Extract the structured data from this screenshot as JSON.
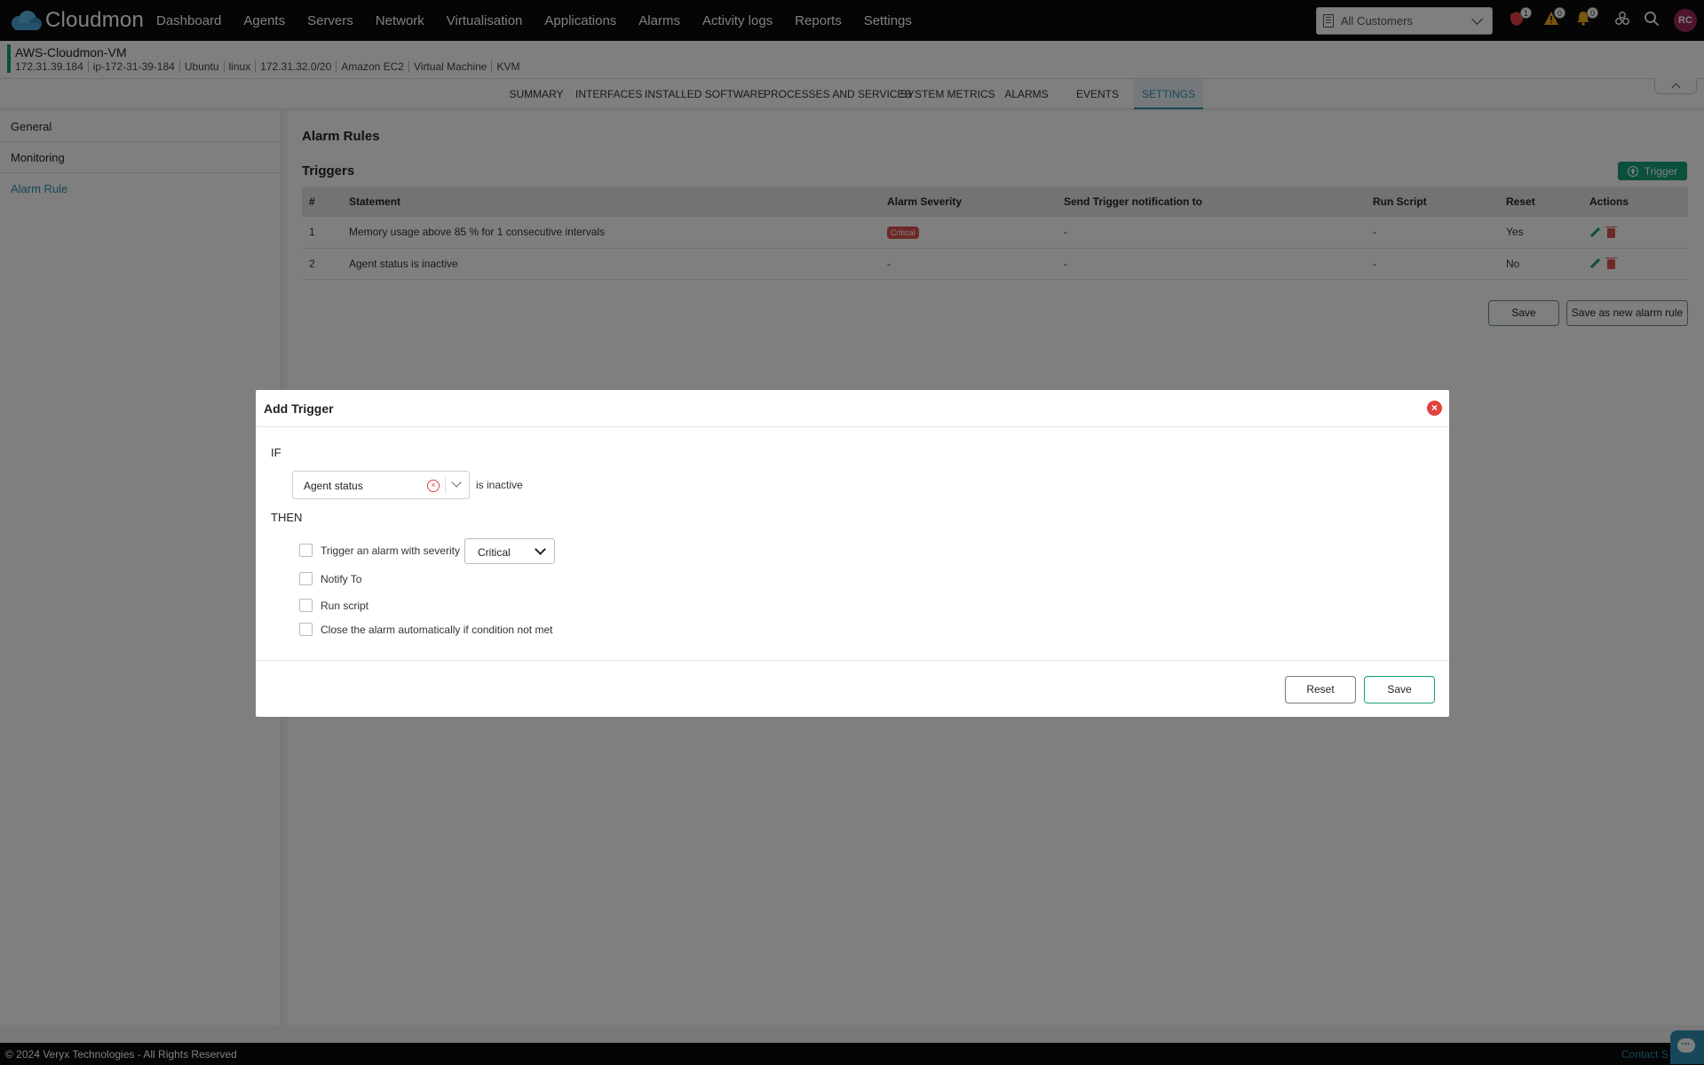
{
  "app": {
    "name": "Cloudmon"
  },
  "nav": [
    "Dashboard",
    "Agents",
    "Servers",
    "Network",
    "Virtualisation",
    "Applications",
    "Alarms",
    "Activity logs",
    "Reports",
    "Settings"
  ],
  "customer_select": {
    "value": "All Customers"
  },
  "notifications": {
    "critical": "1",
    "warning": "0",
    "info": "0"
  },
  "user": {
    "initials": "RC"
  },
  "device": {
    "name": "AWS-Cloudmon-VM",
    "meta": [
      "172.31.39.184",
      "ip-172-31-39-184",
      "Ubuntu",
      "linux",
      "172.31.32.0/20",
      "Amazon EC2",
      "Virtual Machine",
      "KVM"
    ]
  },
  "tabs": [
    "SUMMARY",
    "INTERFACES",
    "INSTALLED SOFTWARE",
    "PROCESSES AND SERVICES",
    "SYSTEM METRICS",
    "ALARMS",
    "EVENTS",
    "SETTINGS"
  ],
  "active_tab": "SETTINGS",
  "leftmenu": [
    "General",
    "Monitoring",
    "Alarm Rule"
  ],
  "active_leftmenu": "Alarm Rule",
  "alarm_rules": {
    "title": "Alarm Rules",
    "triggers_title": "Triggers",
    "add_trigger_label": "Trigger",
    "columns": [
      "#",
      "Statement",
      "Alarm Severity",
      "Send Trigger notification to",
      "Run Script",
      "Reset",
      "Actions"
    ],
    "rows": [
      {
        "num": "1",
        "statement": "Memory usage above 85 % for 1 consecutive intervals",
        "severity": "Critical",
        "notify": "-",
        "script": "-",
        "reset": "Yes"
      },
      {
        "num": "2",
        "statement": "Agent status is inactive",
        "severity": "-",
        "notify": "-",
        "script": "-",
        "reset": "No"
      }
    ],
    "save_label": "Save",
    "save_new_label": "Save as new alarm rule"
  },
  "modal": {
    "title": "Add Trigger",
    "if_label": "IF",
    "metric_value": "Agent status",
    "condition_text": "is inactive",
    "then_label": "THEN",
    "opt_trigger": "Trigger an alarm with severity",
    "severity_value": "Critical",
    "opt_notify": "Notify To",
    "opt_script": "Run script",
    "opt_close": "Close the alarm automatically if condition not met",
    "reset_label": "Reset",
    "save_label": "Save"
  },
  "footer": {
    "copyright": "© 2024 Veryx Technologies - All Rights Reserved",
    "contact": "Contact S"
  },
  "colors": {
    "accent": "#17a07a",
    "link": "#2f8fb3",
    "danger": "#d9534f"
  }
}
